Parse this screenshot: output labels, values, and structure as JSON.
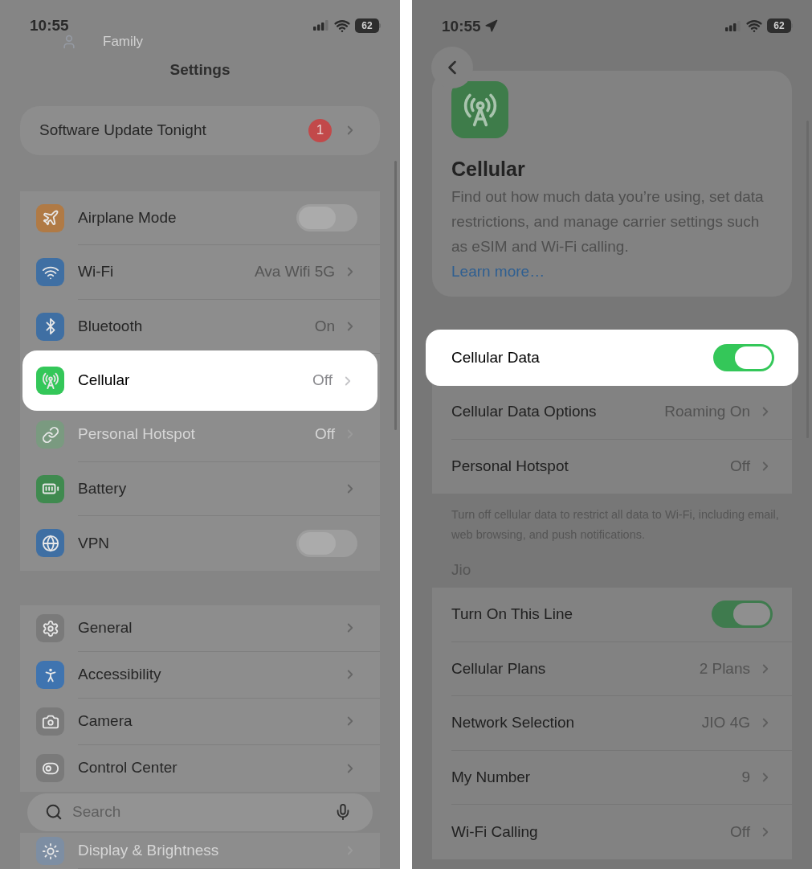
{
  "left_screen": {
    "status_bar": {
      "time": "10:55",
      "battery": "62"
    },
    "account_label": "Family",
    "title": "Settings",
    "update_banner": {
      "label": "Software Update Tonight",
      "badge": "1"
    },
    "groups": [
      {
        "rows": [
          {
            "kind": "toggle",
            "label": "Airplane Mode",
            "on": false,
            "highlighted": false,
            "disabled": false,
            "color": "#b07a45"
          },
          {
            "kind": "link",
            "label": "Wi-Fi",
            "value": "Ava Wifi 5G",
            "highlighted": false,
            "disabled": false,
            "color": "#3f6fa3"
          },
          {
            "kind": "link",
            "label": "Bluetooth",
            "value": "On",
            "highlighted": false,
            "disabled": false,
            "color": "#3f6fa3"
          },
          {
            "kind": "link",
            "label": "Cellular",
            "value": "Off",
            "highlighted": true,
            "disabled": false,
            "color": "#34c759"
          },
          {
            "kind": "link",
            "label": "Personal Hotspot",
            "value": "Off",
            "highlighted": false,
            "disabled": true,
            "color": "#7a9a80"
          },
          {
            "kind": "link",
            "label": "Battery",
            "highlighted": false,
            "disabled": false,
            "color": "#3f8a4f"
          },
          {
            "kind": "toggle",
            "label": "VPN",
            "on": false,
            "highlighted": false,
            "disabled": false,
            "color": "#3f6fa3"
          }
        ]
      },
      {
        "rows": [
          {
            "kind": "link",
            "label": "General",
            "highlighted": false,
            "disabled": false,
            "color": "#7a7a7a"
          },
          {
            "kind": "link",
            "label": "Accessibility",
            "highlighted": false,
            "disabled": false,
            "color": "#3f74b0"
          },
          {
            "kind": "link",
            "label": "Camera",
            "highlighted": false,
            "disabled": false,
            "color": "#7a7a7a"
          },
          {
            "kind": "link",
            "label": "Control Center",
            "highlighted": false,
            "disabled": false,
            "color": "#7a7a7a"
          },
          {
            "kind": "link",
            "label": "Display & Brightness",
            "highlighted": false,
            "disabled": true,
            "color": "#7d8ea3"
          }
        ]
      }
    ],
    "search": {
      "placeholder": "Search"
    }
  },
  "right_screen": {
    "status_bar": {
      "time": "10:55",
      "battery": "62"
    },
    "header": {
      "title": "Cellular",
      "description": "Find out how much data you’re using, set data restrictions, and manage carrier settings such as eSIM and Wi-Fi calling.",
      "link": "Learn more…"
    },
    "groups": [
      {
        "rows": [
          {
            "kind": "toggle",
            "label": "Cellular Data",
            "on": true,
            "highlighted": true
          },
          {
            "kind": "link",
            "label": "Cellular Data Options",
            "value": "Roaming On",
            "highlighted": false
          },
          {
            "kind": "link",
            "label": "Personal Hotspot",
            "value": "Off",
            "highlighted": false
          }
        ],
        "footer": "Turn off cellular data to restrict all data to Wi-Fi, including email, web browsing, and push notifications."
      },
      {
        "header": "Jio",
        "rows": [
          {
            "kind": "toggle",
            "label": "Turn On This Line",
            "on": true,
            "highlighted": false
          },
          {
            "kind": "link",
            "label": "Cellular Plans",
            "value": "2 Plans",
            "highlighted": false
          },
          {
            "kind": "link",
            "label": "Network Selection",
            "value": "JIO 4G",
            "highlighted": false
          },
          {
            "kind": "link",
            "label": "My Number",
            "value": "9",
            "highlighted": false
          },
          {
            "kind": "link",
            "label": "Wi-Fi Calling",
            "value": "Off",
            "highlighted": false
          }
        ]
      }
    ]
  }
}
